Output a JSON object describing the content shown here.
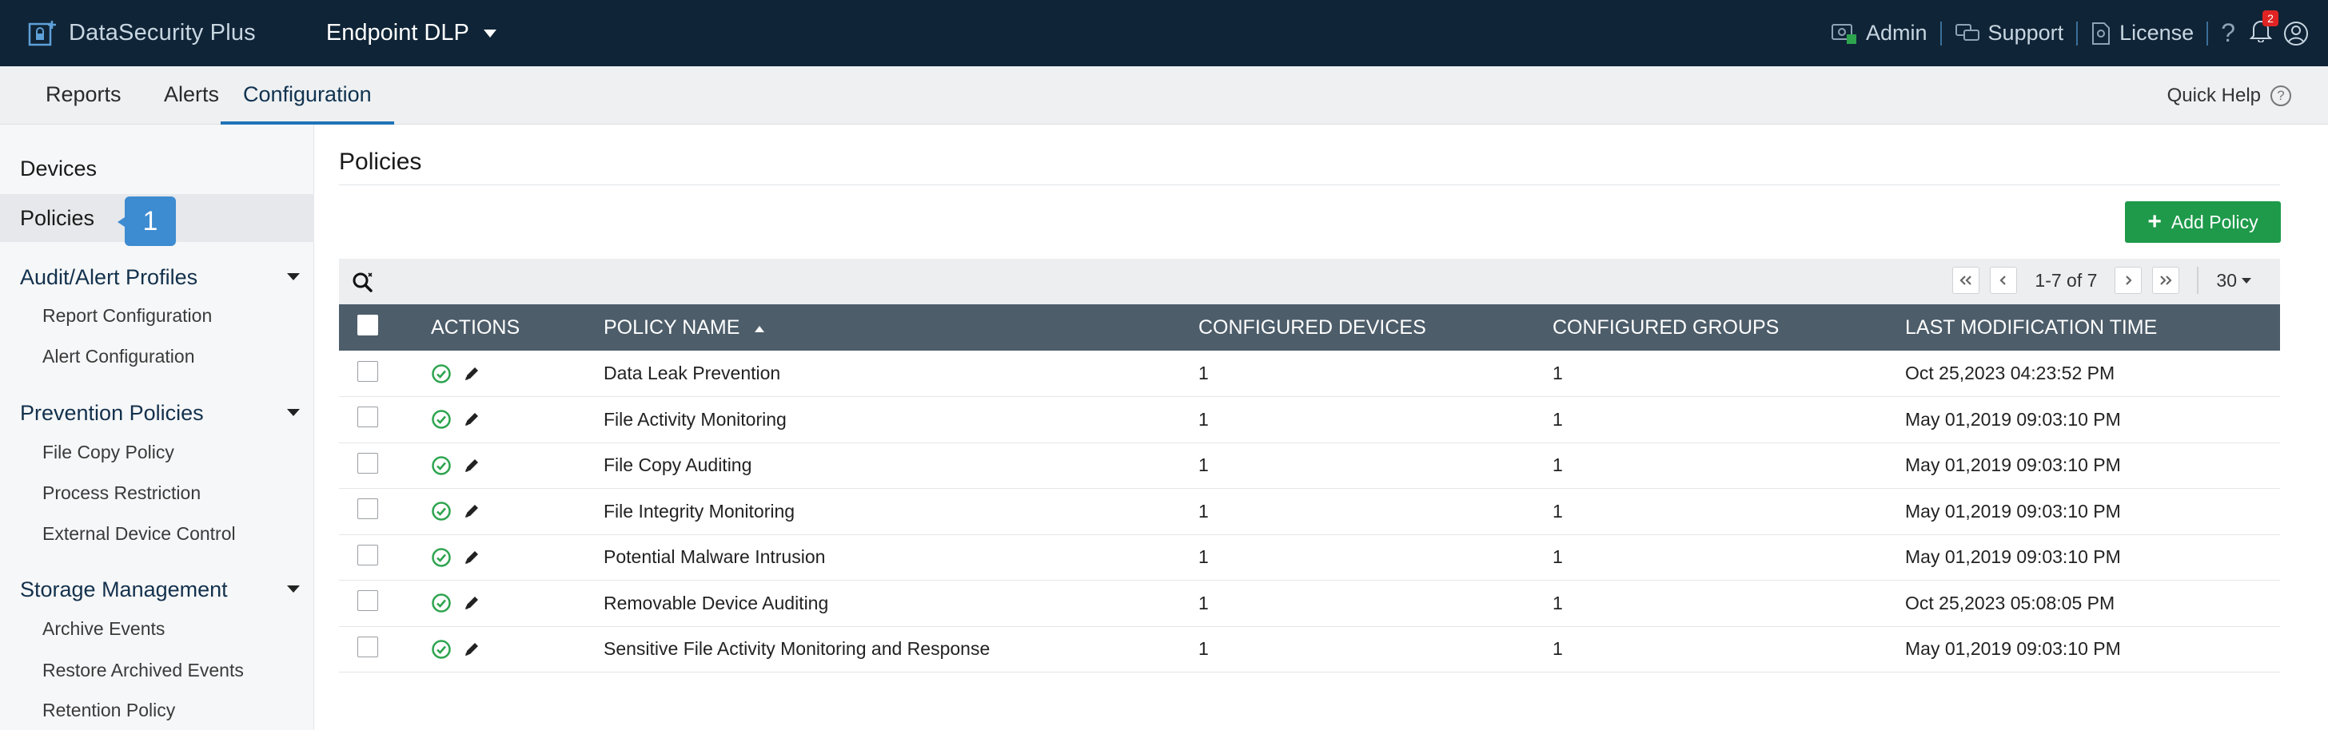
{
  "header": {
    "brand": "DataSecurity Plus",
    "product": "Endpoint DLP",
    "links": {
      "admin": "Admin",
      "support": "Support",
      "license": "License"
    },
    "help_glyph": "?",
    "notification_count": "2"
  },
  "subnav": {
    "tabs": [
      {
        "label": "Reports"
      },
      {
        "label": "Alerts"
      },
      {
        "label": "Configuration",
        "active": true
      }
    ],
    "quick_help": "Quick Help",
    "quick_help_icon": "?"
  },
  "sidebar": {
    "devices": "Devices",
    "policies": "Policies",
    "callout": "1",
    "sections": [
      {
        "title": "Audit/Alert Profiles",
        "items": [
          "Report Configuration",
          "Alert Configuration"
        ]
      },
      {
        "title": "Prevention Policies",
        "items": [
          "File Copy Policy",
          "Process Restriction",
          "External Device Control"
        ]
      },
      {
        "title": "Storage Management",
        "items": [
          "Archive Events",
          "Restore Archived Events",
          "Retention Policy"
        ]
      }
    ]
  },
  "main": {
    "title": "Policies",
    "add_button": "Add Policy",
    "add_button_plus": "+",
    "pager": {
      "info": "1-7 of 7",
      "page_size": "30"
    },
    "columns": [
      "ACTIONS",
      "POLICY NAME",
      "CONFIGURED DEVICES",
      "CONFIGURED GROUPS",
      "LAST MODIFICATION TIME"
    ],
    "rows": [
      {
        "name": "Data Leak Prevention",
        "devices": "1",
        "groups": "1",
        "modified": "Oct 25,2023 04:23:52 PM"
      },
      {
        "name": "File Activity Monitoring",
        "devices": "1",
        "groups": "1",
        "modified": "May 01,2019 09:03:10 PM"
      },
      {
        "name": "File Copy Auditing",
        "devices": "1",
        "groups": "1",
        "modified": "May 01,2019 09:03:10 PM"
      },
      {
        "name": "File Integrity Monitoring",
        "devices": "1",
        "groups": "1",
        "modified": "May 01,2019 09:03:10 PM"
      },
      {
        "name": "Potential Malware Intrusion",
        "devices": "1",
        "groups": "1",
        "modified": "May 01,2019 09:03:10 PM"
      },
      {
        "name": "Removable Device Auditing",
        "devices": "1",
        "groups": "1",
        "modified": "Oct 25,2023 05:08:05 PM"
      },
      {
        "name": "Sensitive File Activity Monitoring and Response",
        "devices": "1",
        "groups": "1",
        "modified": "May 01,2019 09:03:10 PM"
      }
    ]
  },
  "colors": {
    "topbar": "#0f2436",
    "accent": "#1f73b7",
    "add_button": "#1e9a4a",
    "table_header": "#4d5d6a",
    "enabled": "#2ea44f"
  }
}
